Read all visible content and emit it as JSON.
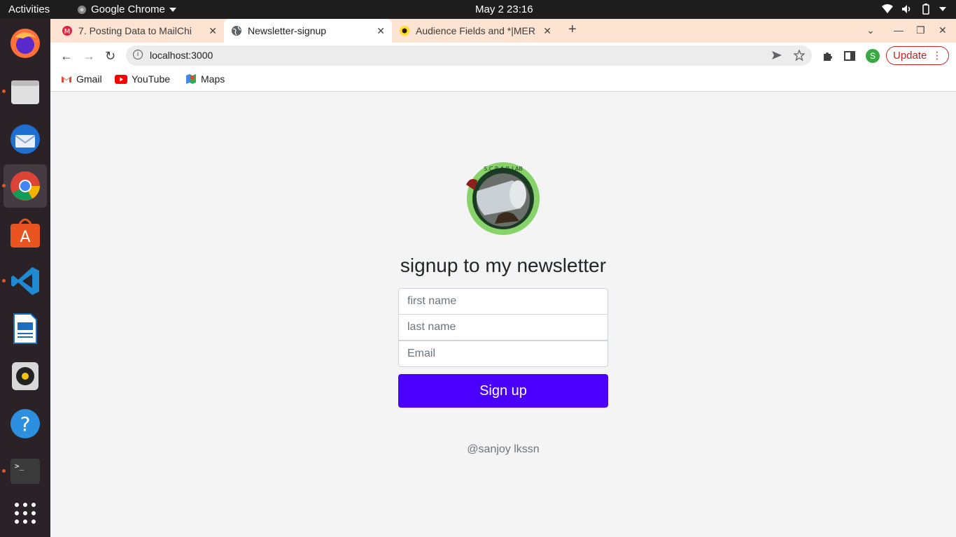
{
  "system_bar": {
    "activities": "Activities",
    "app_name": "Google Chrome",
    "clock": "May 2  23:16"
  },
  "dock": {
    "apps": [
      "Firefox",
      "Files",
      "Thunderbird",
      "Google Chrome",
      "Ubuntu Software",
      "Visual Studio Code",
      "LibreOffice Writer",
      "Rhythmbox",
      "Help",
      "Terminal",
      "Show Applications"
    ]
  },
  "tabs": [
    {
      "title": "7. Posting Data to MailChi",
      "active": false
    },
    {
      "title": "Newsletter-signup",
      "active": true
    },
    {
      "title": "Audience Fields and *|MER",
      "active": false
    }
  ],
  "toolbar": {
    "url": "localhost:3000",
    "profile_initial": "S",
    "update_label": "Update"
  },
  "bookmarks": [
    {
      "label": "Gmail"
    },
    {
      "label": "YouTube"
    },
    {
      "label": "Maps"
    }
  ],
  "form": {
    "heading": "signup to my newsletter",
    "first_name_placeholder": "first name",
    "last_name_placeholder": "last name",
    "email_placeholder": "Email",
    "submit_label": "Sign up",
    "footer": "@sanjoy lkssn",
    "logo_text": "S.C.R.A.P. LAB"
  },
  "colors": {
    "accent": "#4b00ff",
    "tab_strip": "#fde3d2",
    "update_red": "#c5221f"
  }
}
